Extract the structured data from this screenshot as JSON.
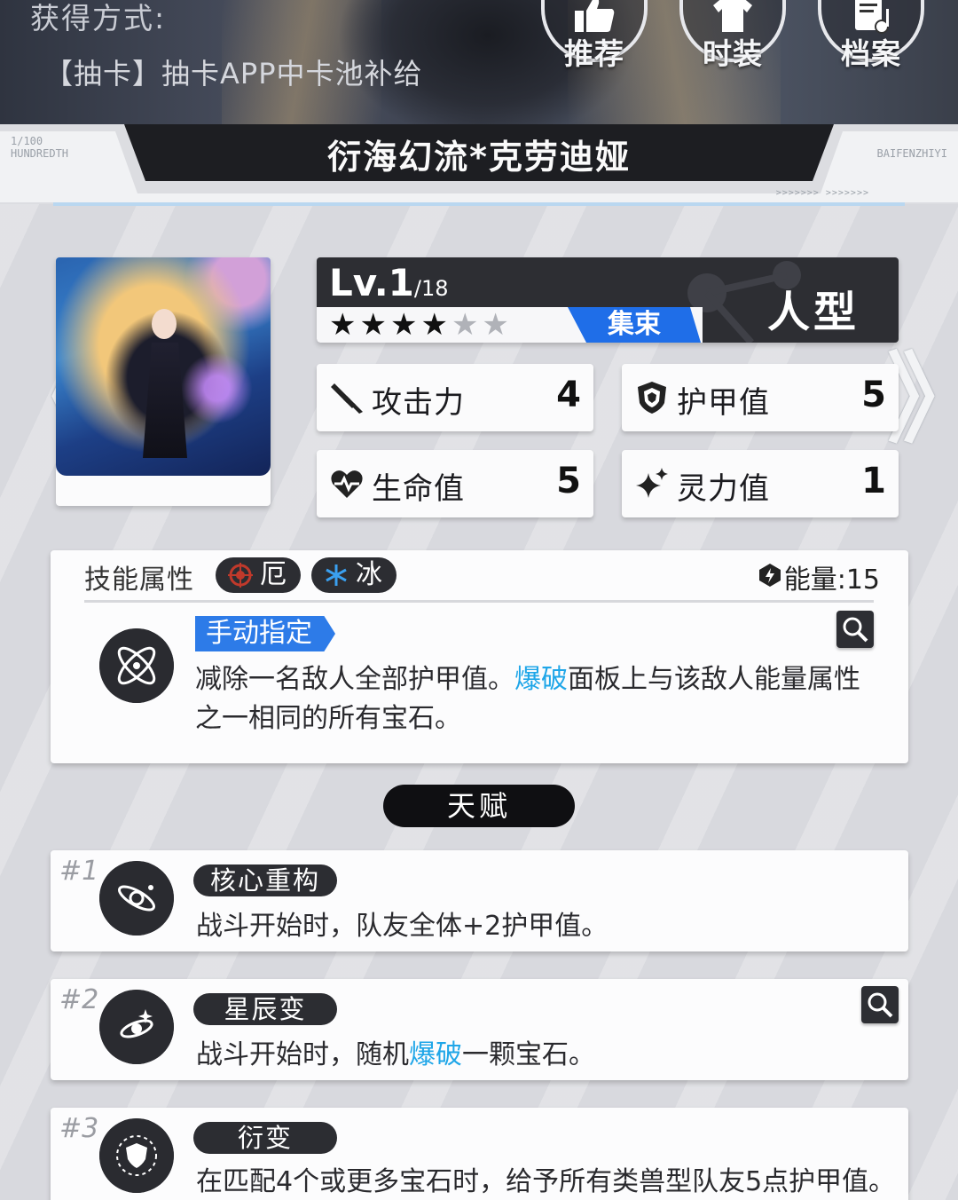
{
  "header": {
    "obtain_label": "获得方式:",
    "obtain_value": "【抽卡】抽卡APP中卡池补给",
    "buttons": [
      {
        "label": "推荐",
        "icon": "thumbs-up-icon"
      },
      {
        "label": "时装",
        "icon": "shirt-icon"
      },
      {
        "label": "档案",
        "icon": "archive-icon"
      }
    ]
  },
  "nameplate": {
    "name": "衍海幻流*克劳迪娅",
    "logo_left_line1": "1/100",
    "logo_left_line2": "HUNDREDTH",
    "logo_right": "BAIFENZHIYI",
    "arrows": ">>>>>>>  >>>>>>>"
  },
  "card": {
    "level_prefix": "Lv.",
    "level": "1",
    "level_max": "/18",
    "stars_filled": 4,
    "stars_total": 6,
    "faction": "集束",
    "type": "人型",
    "nav_prev": "《",
    "nav_next": "》"
  },
  "stats": {
    "attack": {
      "label": "攻击力",
      "value": "4",
      "icon": "sword-icon"
    },
    "armor": {
      "label": "护甲值",
      "value": "5",
      "icon": "shield-icon"
    },
    "hp": {
      "label": "生命值",
      "value": "5",
      "icon": "heart-icon"
    },
    "spirit": {
      "label": "灵力值",
      "value": "1",
      "icon": "sparkle-icon"
    }
  },
  "skill": {
    "attr_label": "技能属性",
    "elements": [
      {
        "label": "厄",
        "icon": "calamity-icon",
        "color": "#c0392b"
      },
      {
        "label": "冰",
        "icon": "snowflake-icon",
        "color": "#3aa0f0"
      }
    ],
    "energy": "能量:15",
    "tag": "手动指定",
    "desc_part1": "减除一名敌人全部护甲值。",
    "desc_highlight": "爆破",
    "desc_part2": "面板上与该敌人能量属性之一相同的所有宝石。"
  },
  "talent_header": "天赋",
  "talents": [
    {
      "num": "#1",
      "name": "核心重构",
      "desc_pre": "战斗开始时，队友全体+2护甲值。",
      "desc_hl": "",
      "desc_post": ""
    },
    {
      "num": "#2",
      "name": "星辰变",
      "desc_pre": "战斗开始时，随机",
      "desc_hl": "爆破",
      "desc_post": "一颗宝石。"
    },
    {
      "num": "#3",
      "name": "衍变",
      "desc_pre": "在匹配4个或更多宝石时，给予所有类兽型队友5点护甲值。",
      "desc_hl": "",
      "desc_post": ""
    }
  ],
  "colors": {
    "accent_blue": "#1f6ee8",
    "highlight": "#1fa6e8",
    "dark": "#2d2e33"
  }
}
